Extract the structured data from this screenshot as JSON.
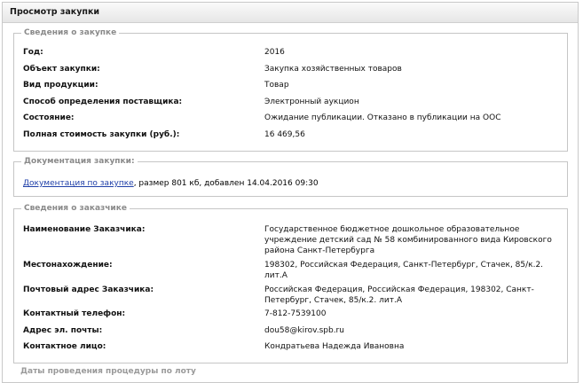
{
  "window": {
    "title": "Просмотр закупки"
  },
  "purchase": {
    "legend": "Сведения о закупке",
    "rows": [
      {
        "label": "Год:",
        "value": "2016"
      },
      {
        "label": "Объект закупки:",
        "value": "Закупка хозяйственных товаров"
      },
      {
        "label": "Вид продукции:",
        "value": "Товар"
      },
      {
        "label": "Способ определения поставщика:",
        "value": "Электронный аукцион"
      },
      {
        "label": "Состояние:",
        "value": "Ожидание публикации. Отказано в публикации на ООС"
      },
      {
        "label": "Полная стоимость закупки (руб.):",
        "value": "16 469,56"
      }
    ]
  },
  "documentation": {
    "legend": "Документация закупки:",
    "link_text": "Документация по закупке",
    "details": ", размер 801 кб, добавлен 14.04.2016 09:30"
  },
  "customer": {
    "legend": "Сведения о заказчике",
    "rows": [
      {
        "label": "Наименование Заказчика:",
        "value": "Государственное бюджетное дошкольное образовательное учреждение детский сад № 58 комбинированного вида Кировского района Санкт-Петербурга"
      },
      {
        "label": "Местонахождение:",
        "value": "198302, Российская Федерация, Санкт-Петербург, Стачек, 85/к.2. лит.А"
      },
      {
        "label": "Почтовый адрес Заказчика:",
        "value": "Российская Федерация, Российская Федерация, 198302, Санкт-Петербург, Стачек, 85/к.2. лит.А"
      },
      {
        "label": "Контактный телефон:",
        "value": "7-812-7539100"
      },
      {
        "label": "Адрес эл. почты:",
        "value": "dou58@kirov.spb.ru"
      },
      {
        "label": "Контактное лицо:",
        "value": "Кондратьева Надежда Ивановна"
      }
    ]
  },
  "next_section": {
    "legend": "Даты проведения процедуры по лоту"
  }
}
